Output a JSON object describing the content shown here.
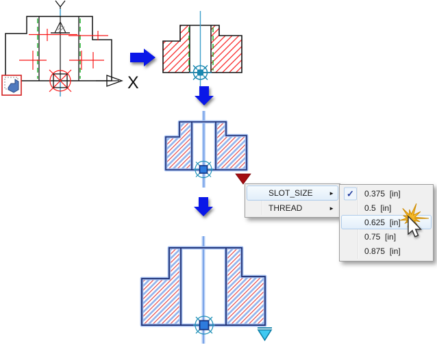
{
  "axes": {
    "x_label": "X",
    "y_label": "Y"
  },
  "grip_menu": {
    "items": [
      {
        "label": "SLOT_SIZE",
        "highlighted": true,
        "has_submenu": true
      },
      {
        "label": "THREAD",
        "highlighted": false,
        "has_submenu": true
      }
    ],
    "submenu": {
      "items": [
        {
          "label": "0.375  [in]",
          "checked": true,
          "highlighted": false
        },
        {
          "label": "0.5  [in]",
          "checked": false,
          "highlighted": false
        },
        {
          "label": "0.625  [in]",
          "checked": false,
          "highlighted": true
        },
        {
          "label": "0.75  [in]",
          "checked": false,
          "highlighted": false
        },
        {
          "label": "0.875  [in]",
          "checked": false,
          "highlighted": false
        }
      ]
    }
  },
  "icons": {
    "submenu_arrow": "►",
    "checkmark": "✓"
  },
  "colors": {
    "flow_arrow": "#0A17E8",
    "hatch_red": "#F81616",
    "sketch_green": "#00A310",
    "centerline_cyan": "#3D9DCB",
    "selection_halo": "#9FBBEF",
    "selection_core": "#1A2A6E",
    "grip_blue": "#2E7BDE",
    "grip_red": "#A30D12",
    "grip_cyan": "#3FC9F2",
    "marker_teal": "#1887B0",
    "menu_highlight_border": "#AECBEA",
    "click_flash_gold": "#F5B929"
  }
}
